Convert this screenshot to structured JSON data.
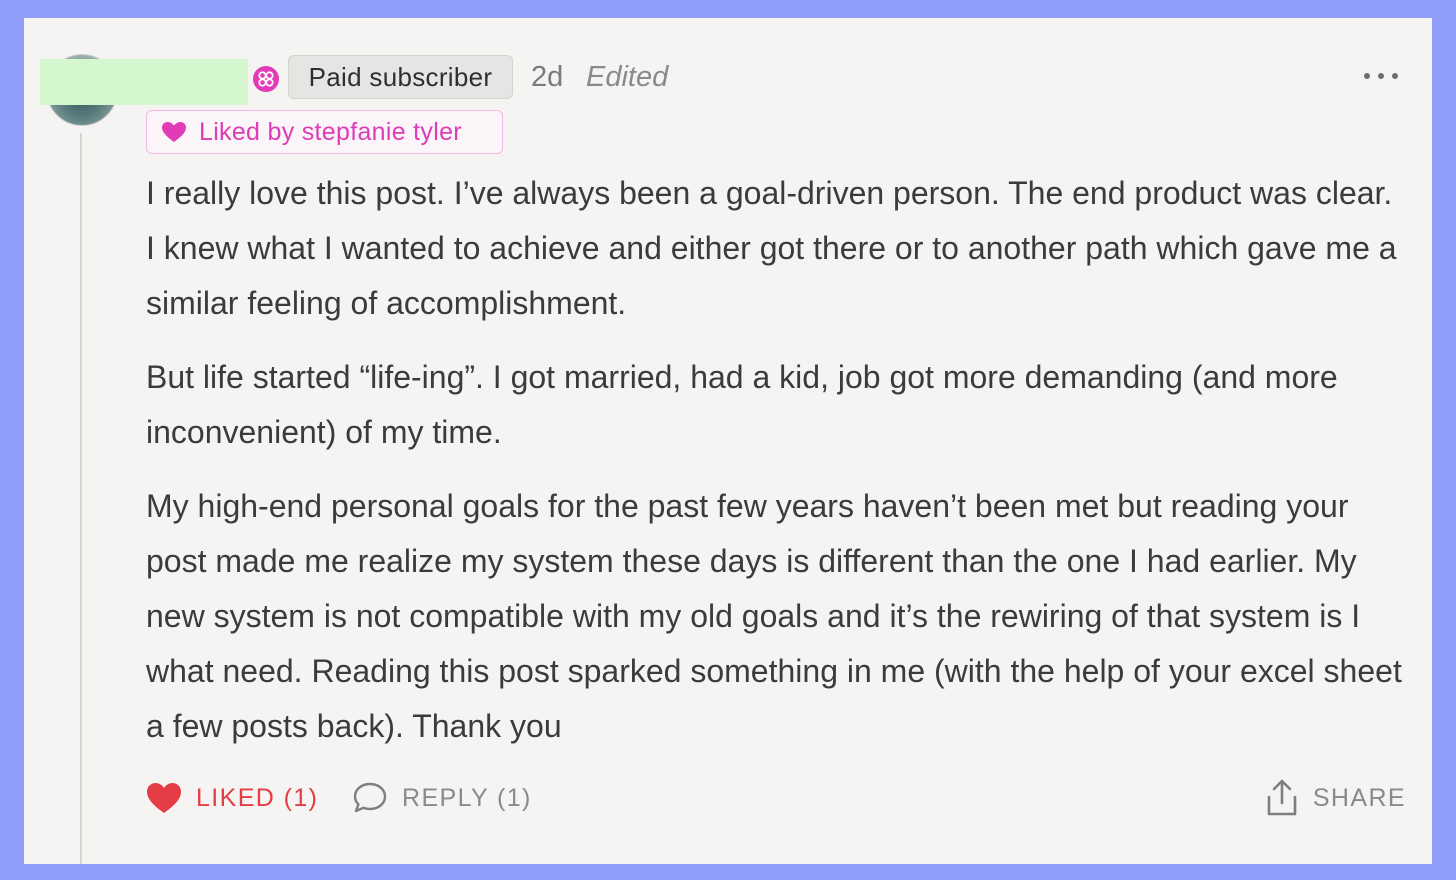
{
  "comment": {
    "badge": "Paid subscriber",
    "time": "2d",
    "edited": "Edited",
    "liked_by": "Liked by stepfanie tyler",
    "paragraphs": [
      "I really love this post. I’ve always been a goal-driven person. The end product was clear. I knew what I wanted to achieve and either got there or to another path which gave me a similar feeling of accomplishment.",
      "But life started “life-ing”. I got married, had a kid, job got more demanding (and more inconvenient) of my time.",
      "My high-end personal goals for the past few years haven’t been met but reading your post made me realize my system these days is different than the one I had earlier. My new system is not compatible with my old goals and it’s the rewiring of that system is I what need. Reading this post sparked something in me (with the help of your excel sheet a few posts back). Thank you"
    ]
  },
  "actions": {
    "like_label": "LIKED (1)",
    "reply_label": "REPLY (1)",
    "share_label": "SHARE"
  },
  "icons": {
    "like": "heart-icon",
    "reply": "speech-bubble-icon",
    "share": "share-upload-icon",
    "more": "ellipsis-icon",
    "subscriber": "subscriber-flower-icon"
  },
  "colors": {
    "background_frame": "#8f9cf8",
    "card": "#f5f4f2",
    "liked_pink": "#de3bb6",
    "like_red": "#e53d46",
    "muted_text": "#8a8a8a"
  }
}
